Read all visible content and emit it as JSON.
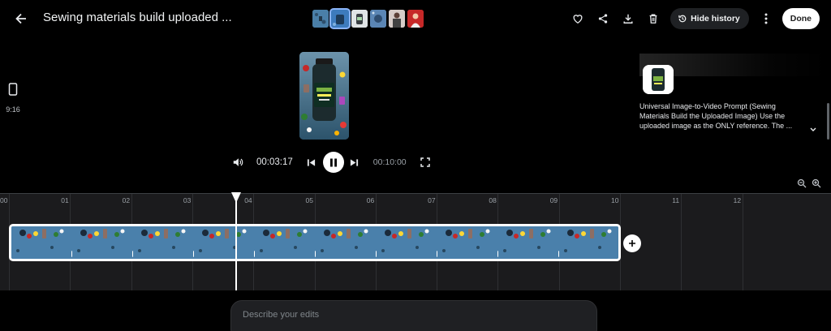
{
  "header": {
    "title": "Sewing materials build uploaded ...",
    "hide_history_label": "Hide history",
    "done_label": "Done"
  },
  "thumbnails": [
    {
      "name": "thumb-1",
      "color": "#4a7fa8"
    },
    {
      "name": "thumb-2",
      "color": "#3d7bbd",
      "active": true
    },
    {
      "name": "thumb-3",
      "color": "#cfd8dc"
    },
    {
      "name": "thumb-4",
      "color": "#5b86b5"
    },
    {
      "name": "thumb-5",
      "color": "#d7ccc8"
    },
    {
      "name": "thumb-6",
      "color": "#c62828"
    }
  ],
  "aspect": {
    "label": "9:16"
  },
  "player": {
    "current_time": "00:03:17",
    "total_time": "00:10:00",
    "progress_fraction": 0.3
  },
  "history": {
    "prompt_text": "Universal Image-to-Video Prompt (Sewing Materials Build the Uploaded Image) Use the uploaded image as the ONLY reference. The ..."
  },
  "timeline": {
    "ticks": [
      "00",
      "01",
      "02",
      "03",
      "04",
      "05",
      "06",
      "07",
      "08",
      "09",
      "10",
      "11",
      "12"
    ]
  },
  "prompt": {
    "placeholder": "Describe your edits"
  },
  "colors": {
    "accent": "#8ab4f8",
    "clip_blue": "#4a7fa8",
    "background": "#000000",
    "timeline_bg": "#1b1b1d"
  }
}
